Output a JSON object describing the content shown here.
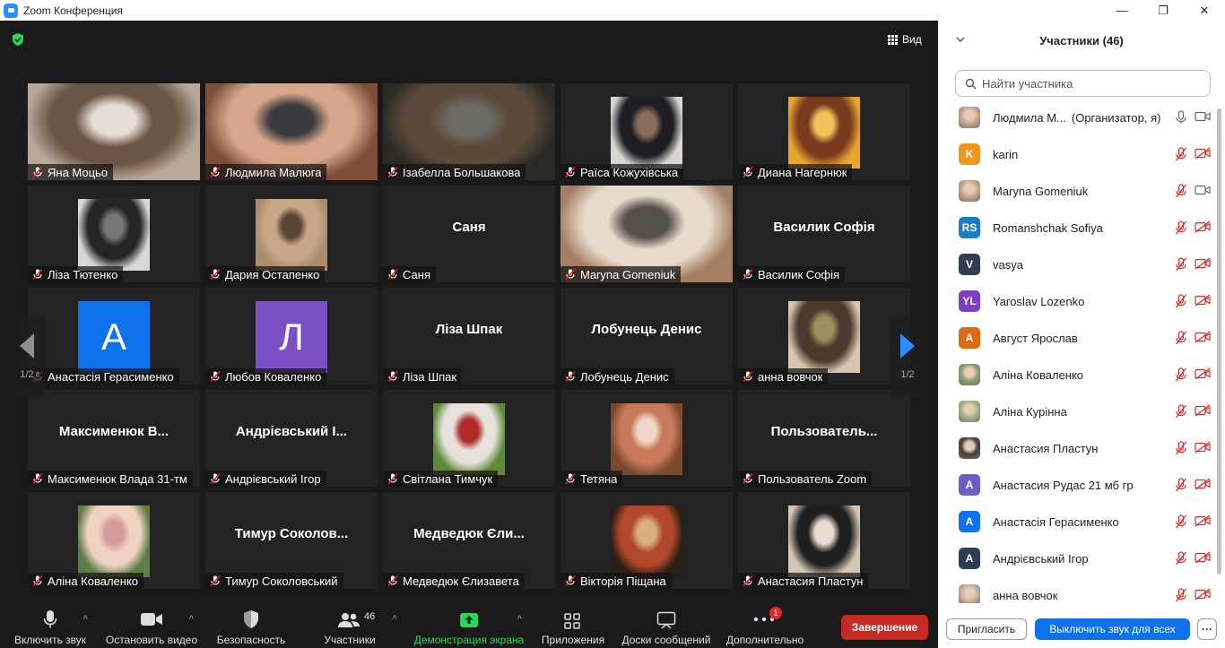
{
  "window": {
    "title": "Zoom Конференция",
    "controls": [
      "—",
      "❐",
      "✕"
    ]
  },
  "meeting": {
    "view_label": "Вид",
    "page_left": "1/2",
    "page_right": "1/2",
    "tiles": [
      {
        "name": "Яна Моцьо",
        "kind": "video",
        "colors": [
          "#b9a89a",
          "#6b5546",
          "#e6ddd5"
        ]
      },
      {
        "name": "Людмила Малюга",
        "kind": "video",
        "active": true,
        "colors": [
          "#7d4e3a",
          "#d6a58a",
          "#3b3a3f"
        ]
      },
      {
        "name": "Ізабелла Большакова",
        "kind": "video",
        "colors": [
          "#2b2a25",
          "#5b4a3a",
          "#6a6a62"
        ]
      },
      {
        "name": "Раїса Кожухівська",
        "kind": "photo",
        "colors": [
          "#d9d6d2",
          "#1e1e24",
          "#8a6c5a"
        ]
      },
      {
        "name": "Диана Нагернюк",
        "kind": "photo",
        "colors": [
          "#e8a530",
          "#7a3a1e",
          "#f2c15b"
        ]
      },
      {
        "name": "Ліза Тютенко",
        "kind": "photo",
        "colors": [
          "#d8d8d8",
          "#262626",
          "#777777"
        ]
      },
      {
        "name": "Дария Остапенко",
        "kind": "photo",
        "colors": [
          "#a88c70",
          "#c9a888",
          "#5a4636"
        ]
      },
      {
        "name": "Саня",
        "kind": "name",
        "big": "Саня"
      },
      {
        "name": "Maryna Gomeniuk",
        "kind": "video",
        "colors": [
          "#a47e62",
          "#e8dacb",
          "#555048"
        ]
      },
      {
        "name": "Василик Софія",
        "kind": "name",
        "big": "Василик Софія"
      },
      {
        "name": "Анастасія Герасименко",
        "kind": "letter",
        "letter": "A",
        "color": "#0e72ed"
      },
      {
        "name": "Любов Коваленко",
        "kind": "letter",
        "letter": "Л",
        "color": "#7a50c4"
      },
      {
        "name": "Ліза Шпак",
        "kind": "name",
        "big": "Ліза Шпак"
      },
      {
        "name": "Лобунець Денис",
        "kind": "name",
        "big": "Лобунець Денис"
      },
      {
        "name": "анна вовчок",
        "kind": "photo",
        "colors": [
          "#d7c5b0",
          "#4a3a2e",
          "#9c8f60"
        ]
      },
      {
        "name": "Максименюк Влада 31-тм",
        "kind": "name",
        "big": "Максименюк  В..."
      },
      {
        "name": "Андрієвський Ігор",
        "kind": "name",
        "big": "Андрієвський І..."
      },
      {
        "name": "Світлана Тимчук",
        "kind": "photo",
        "colors": [
          "#5d8a3a",
          "#e6e1da",
          "#b02a2a"
        ]
      },
      {
        "name": "Тетяна",
        "kind": "photo",
        "colors": [
          "#7a4a2e",
          "#c87a5a",
          "#f0d8c8"
        ]
      },
      {
        "name": "Пользователь Zoom",
        "kind": "name",
        "big": "Пользователь..."
      },
      {
        "name": "Аліна Коваленко",
        "kind": "photo",
        "colors": [
          "#5e7d4a",
          "#f0d2c2",
          "#d59a9a"
        ]
      },
      {
        "name": "Тимур Соколовський",
        "kind": "name",
        "big": "Тимур  Соколов..."
      },
      {
        "name": "Медведюк Єлизавета",
        "kind": "name",
        "big": "Медведюк Єли..."
      },
      {
        "name": "Вікторія Піщана",
        "kind": "photo",
        "colors": [
          "#2a1e16",
          "#b2482a",
          "#d7b07a"
        ]
      },
      {
        "name": "Анастасия Пластун",
        "kind": "photo",
        "colors": [
          "#d4c6b6",
          "#1f1f1f",
          "#e9dbcf"
        ]
      }
    ]
  },
  "toolbar": {
    "unmute": "Включить звук",
    "stop_video": "Остановить видео",
    "security": "Безопасность",
    "participants": "Участники",
    "participants_count": "46",
    "share": "Демонстрация экрана",
    "apps": "Приложения",
    "whiteboards": "Доски сообщений",
    "more": "Дополнительно",
    "more_badge": "1",
    "end": "Завершение",
    "share_color": "#23d959"
  },
  "panel": {
    "title": "Участники (46)",
    "search_placeholder": "Найти участника",
    "invite": "Пригласить",
    "mute_all": "Выключить звук для всех",
    "more": "···",
    "participants": [
      {
        "name": "Людмила М...",
        "roles": "(Организатор, я)",
        "avatar_type": "photo",
        "color": "#c8a58e",
        "mic": "on",
        "video": "on"
      },
      {
        "name": "karin",
        "avatar_type": "letter",
        "letter": "K",
        "color": "#f0961e",
        "mic": "off",
        "video": "off"
      },
      {
        "name": "Maryna Gomeniuk",
        "avatar_type": "photo",
        "color": "#c9a787",
        "mic": "off",
        "video": "on"
      },
      {
        "name": "Romanshchak Sofiya",
        "avatar_type": "letter",
        "letter": "RS",
        "color": "#1a7bc6",
        "mic": "off",
        "video": "off"
      },
      {
        "name": "vasya",
        "avatar_type": "letter",
        "letter": "V",
        "color": "#2f3e55",
        "mic": "off",
        "video": "off"
      },
      {
        "name": "Yaroslav Lozenko",
        "avatar_type": "letter",
        "letter": "YL",
        "color": "#7c3fc2",
        "mic": "off",
        "video": "off"
      },
      {
        "name": "Август Ярослав",
        "avatar_type": "letter",
        "letter": "А",
        "color": "#e06a12",
        "mic": "off",
        "video": "off"
      },
      {
        "name": "Аліна Коваленко",
        "avatar_type": "photo",
        "color": "#8aa070",
        "mic": "off",
        "video": "off"
      },
      {
        "name": "Аліна Курінна",
        "avatar_type": "photo",
        "color": "#a7b28a",
        "mic": "off",
        "video": "off"
      },
      {
        "name": "Анастасия Пластун",
        "avatar_type": "photo",
        "color": "#4a3a32",
        "mic": "off",
        "video": "off"
      },
      {
        "name": "Анастасия Рудас 21 мб гр",
        "avatar_type": "letter",
        "letter": "A",
        "color": "#6e5cc9",
        "mic": "off",
        "video": "off"
      },
      {
        "name": "Анастасія Герасименко",
        "avatar_type": "letter",
        "letter": "A",
        "color": "#0e72ed",
        "mic": "off",
        "video": "off"
      },
      {
        "name": "Андрієвський Ігор",
        "avatar_type": "letter",
        "letter": "A",
        "color": "#2f3e55",
        "mic": "off",
        "video": "off"
      },
      {
        "name": "анна вовчок",
        "avatar_type": "photo",
        "color": "#c8b09a",
        "mic": "off",
        "video": "off"
      }
    ]
  }
}
